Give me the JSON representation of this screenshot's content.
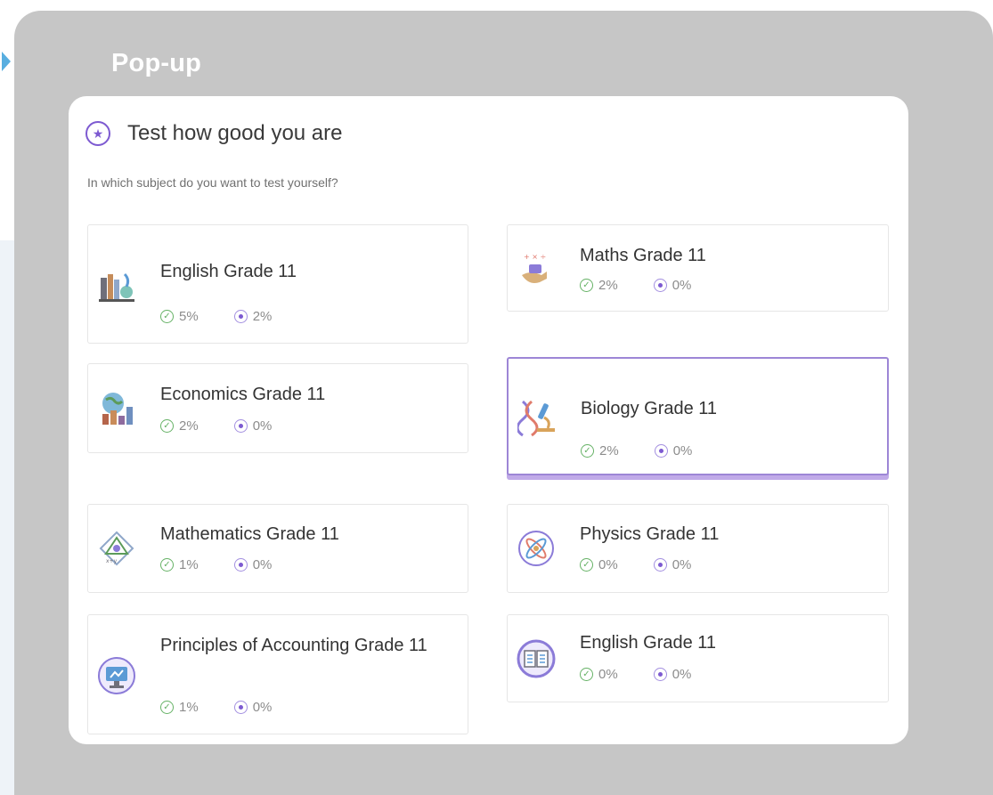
{
  "popup_label": "Pop-up",
  "dialog": {
    "title": "Test how good you are",
    "subtitle": "In which subject do you want to test yourself?",
    "subjects": [
      {
        "name": "English Grade 11",
        "completed": "5%",
        "score": "2%",
        "icon": "books-icon"
      },
      {
        "name": "Maths Grade 11",
        "completed": "2%",
        "score": "0%",
        "icon": "math-hand-icon"
      },
      {
        "name": "Economics Grade 11",
        "completed": "2%",
        "score": "0%",
        "icon": "globe-chart-icon"
      },
      {
        "name": "Biology Grade 11",
        "completed": "2%",
        "score": "0%",
        "icon": "dna-microscope-icon",
        "selected": true
      },
      {
        "name": "Mathematics Grade 11",
        "completed": "1%",
        "score": "0%",
        "icon": "geometry-icon"
      },
      {
        "name": "Physics Grade 11",
        "completed": "0%",
        "score": "0%",
        "icon": "atom-icon"
      },
      {
        "name": "Principles of Accounting Grade 11",
        "completed": "1%",
        "score": "0%",
        "icon": "monitor-icon"
      },
      {
        "name": "English Grade 11",
        "completed": "0%",
        "score": "0%",
        "icon": "book-circle-icon"
      }
    ]
  },
  "colors": {
    "accent": "#7d5ad1",
    "completed_green": "#66b266",
    "overlay": "#c6c6c6",
    "selected_border": "#9d86d6"
  }
}
